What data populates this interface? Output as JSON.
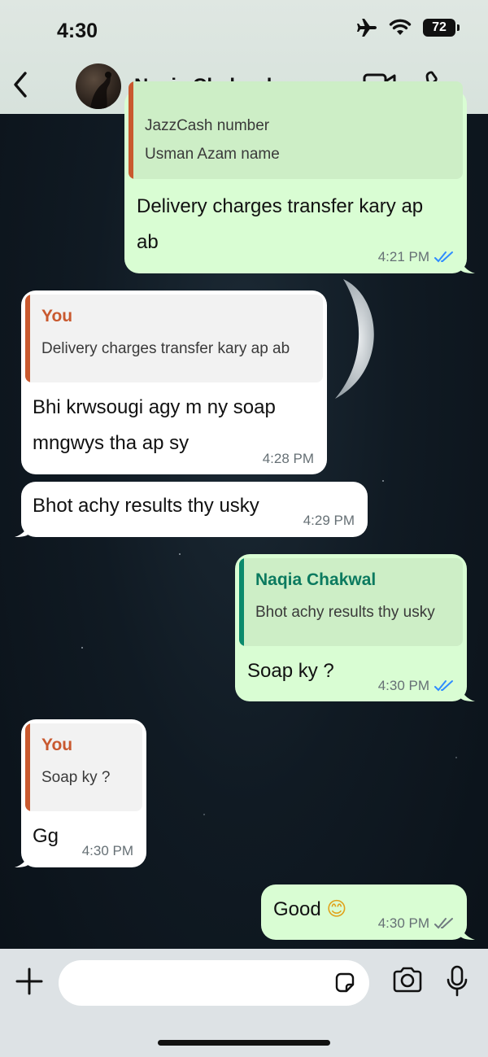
{
  "status": {
    "time": "4:30",
    "battery": "72"
  },
  "contact": {
    "name": "Naqia Chakwal"
  },
  "messages": {
    "m1": {
      "quote_line1": "JazzCash number",
      "quote_line2": "Usman Azam name",
      "text_line1": "Delivery charges transfer kary ap",
      "text_line2": "ab",
      "time": "4:21 PM"
    },
    "m2": {
      "quote_author": "You",
      "quote_text": "Delivery charges transfer kary ap ab",
      "text_line1": "Bhi krwsougi agy m ny soap",
      "text_line2": "mngwys tha ap sy",
      "time": "4:28 PM"
    },
    "m3": {
      "text": "Bhot achy results thy usky",
      "time": "4:29 PM"
    },
    "m4": {
      "quote_author": "Naqia Chakwal",
      "quote_text": "Bhot achy results thy usky",
      "text": "Soap ky ?",
      "time": "4:30 PM"
    },
    "m5": {
      "quote_author": "You",
      "quote_text": "Soap ky ?",
      "text": "Gg",
      "time": "4:30 PM"
    },
    "m6": {
      "text": "Good",
      "emoji": "😊",
      "time": "4:30 PM"
    }
  },
  "colors": {
    "outgoing_bubble": "#d9fdd3",
    "incoming_bubble": "#ffffff",
    "read_tick": "#2f8cff",
    "quote_you": "#c9592f",
    "quote_contact": "#0b8a6c"
  },
  "icons": [
    "airplane-icon",
    "wifi-icon",
    "battery-icon",
    "back-chevron-icon",
    "video-call-icon",
    "phone-icon",
    "plus-icon",
    "sticker-icon",
    "camera-icon",
    "microphone-icon",
    "double-check-icon"
  ]
}
